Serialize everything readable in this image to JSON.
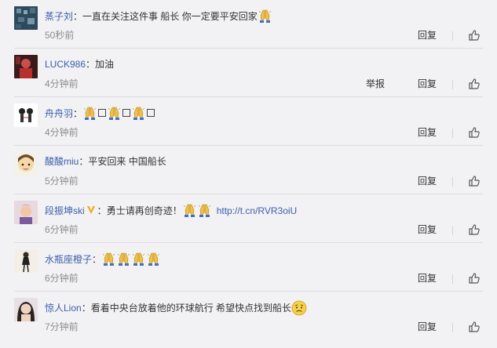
{
  "comments": [
    {
      "user": "蒸子刘",
      "text": "一直在关注这件事 船长 你一定要平安回家",
      "time": "50秒前",
      "reply": "回复"
    },
    {
      "user": "LUCK986",
      "text": "加油",
      "time": "4分钟前",
      "report": "举报",
      "reply": "回复"
    },
    {
      "user": "舟舟羽",
      "text": "",
      "time": "4分钟前",
      "reply": "回复"
    },
    {
      "user": "酸酸miu",
      "text": "平安回来 中国船长",
      "time": "5分钟前",
      "reply": "回复"
    },
    {
      "user": "段振坤ski",
      "text": "勇士请再创奇迹！",
      "link": "http://t.cn/RVR3oiU",
      "time": "6分钟前",
      "reply": "回复"
    },
    {
      "user": "水瓶座橙子",
      "text": "",
      "time": "6分钟前",
      "reply": "回复"
    },
    {
      "user": "惊人Lion",
      "text": "看着中央台放着他的环球航行 希望快点找到船长",
      "time": "7分钟前",
      "reply": "回复"
    }
  ],
  "colon": "：",
  "icons": {
    "like": "thumbs-up-icon",
    "emoji": "praying-hands-icon",
    "verified": "verified-v-icon",
    "face": "worried-face-icon"
  },
  "colors": {
    "username": "#3b5ea9",
    "meta": "#8c8c8c",
    "background": "#f2f2f5"
  }
}
